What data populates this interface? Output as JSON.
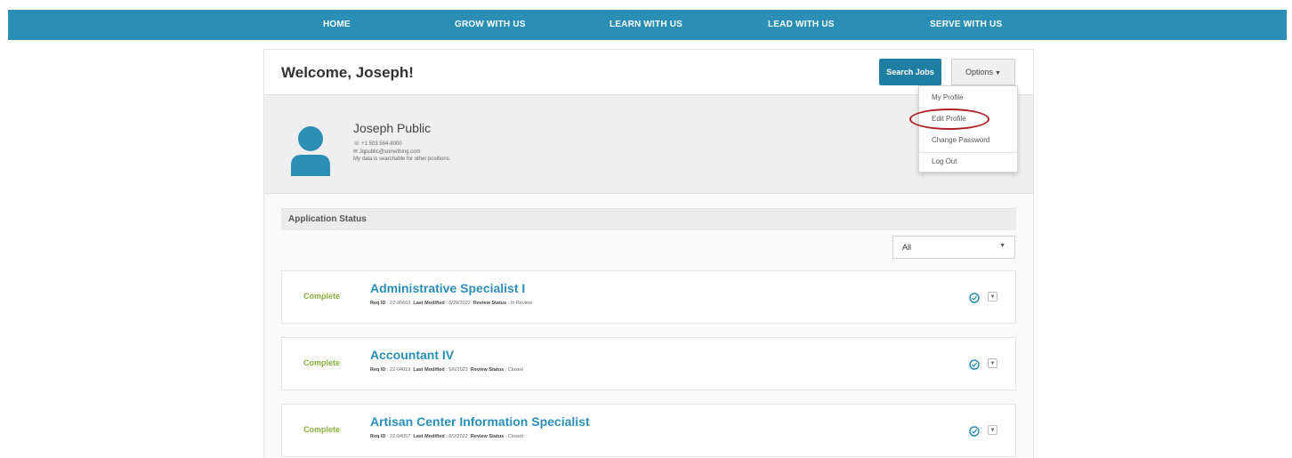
{
  "nav": {
    "items": [
      {
        "label": "HOME"
      },
      {
        "label": "GROW WITH US"
      },
      {
        "label": "LEARN WITH US"
      },
      {
        "label": "LEAD WITH US"
      },
      {
        "label": "SERVE WITH US"
      }
    ]
  },
  "header": {
    "welcome": "Welcome, Joseph!",
    "search_button": "Search Jobs",
    "options_button": "Options"
  },
  "options_menu": {
    "items": [
      {
        "label": "My Profile"
      },
      {
        "label": "Edit Profile"
      },
      {
        "label": "Change Password"
      },
      {
        "label": "Log Out"
      }
    ],
    "highlighted": "Edit Profile",
    "highlight_color": "#b01e23"
  },
  "profile": {
    "name": "Joseph Public",
    "phone": "+1 503 564-8000",
    "email": "Jqpublic@something.com",
    "note": "My data is searchable for other positions."
  },
  "applications": {
    "heading": "Application Status",
    "filter_value": "All",
    "items": [
      {
        "status": "Complete",
        "title": "Administrative Specialist I",
        "req_label": "Req ID",
        "req_id": "22-06663",
        "modified_label": "Last Modified",
        "last_modified": "6/28/2022",
        "review_label": "Review Status",
        "review_status": "In Review"
      },
      {
        "status": "Complete",
        "title": "Accountant IV",
        "req_label": "Req ID",
        "req_id": "22-04019",
        "modified_label": "Last Modified",
        "last_modified": "5/6/2022",
        "review_label": "Review Status",
        "review_status": "Closed"
      },
      {
        "status": "Complete",
        "title": "Artisan Center Information Specialist",
        "req_label": "Req ID",
        "req_id": "22-04057",
        "modified_label": "Last Modified",
        "last_modified": "6/2/2022",
        "review_label": "Review Status",
        "review_status": "Closed"
      }
    ]
  },
  "colors": {
    "nav_bar": "#2b8fb5",
    "primary_button": "#1f7fa3",
    "status_complete": "#8ab13f",
    "job_link": "#2b8fb5"
  }
}
